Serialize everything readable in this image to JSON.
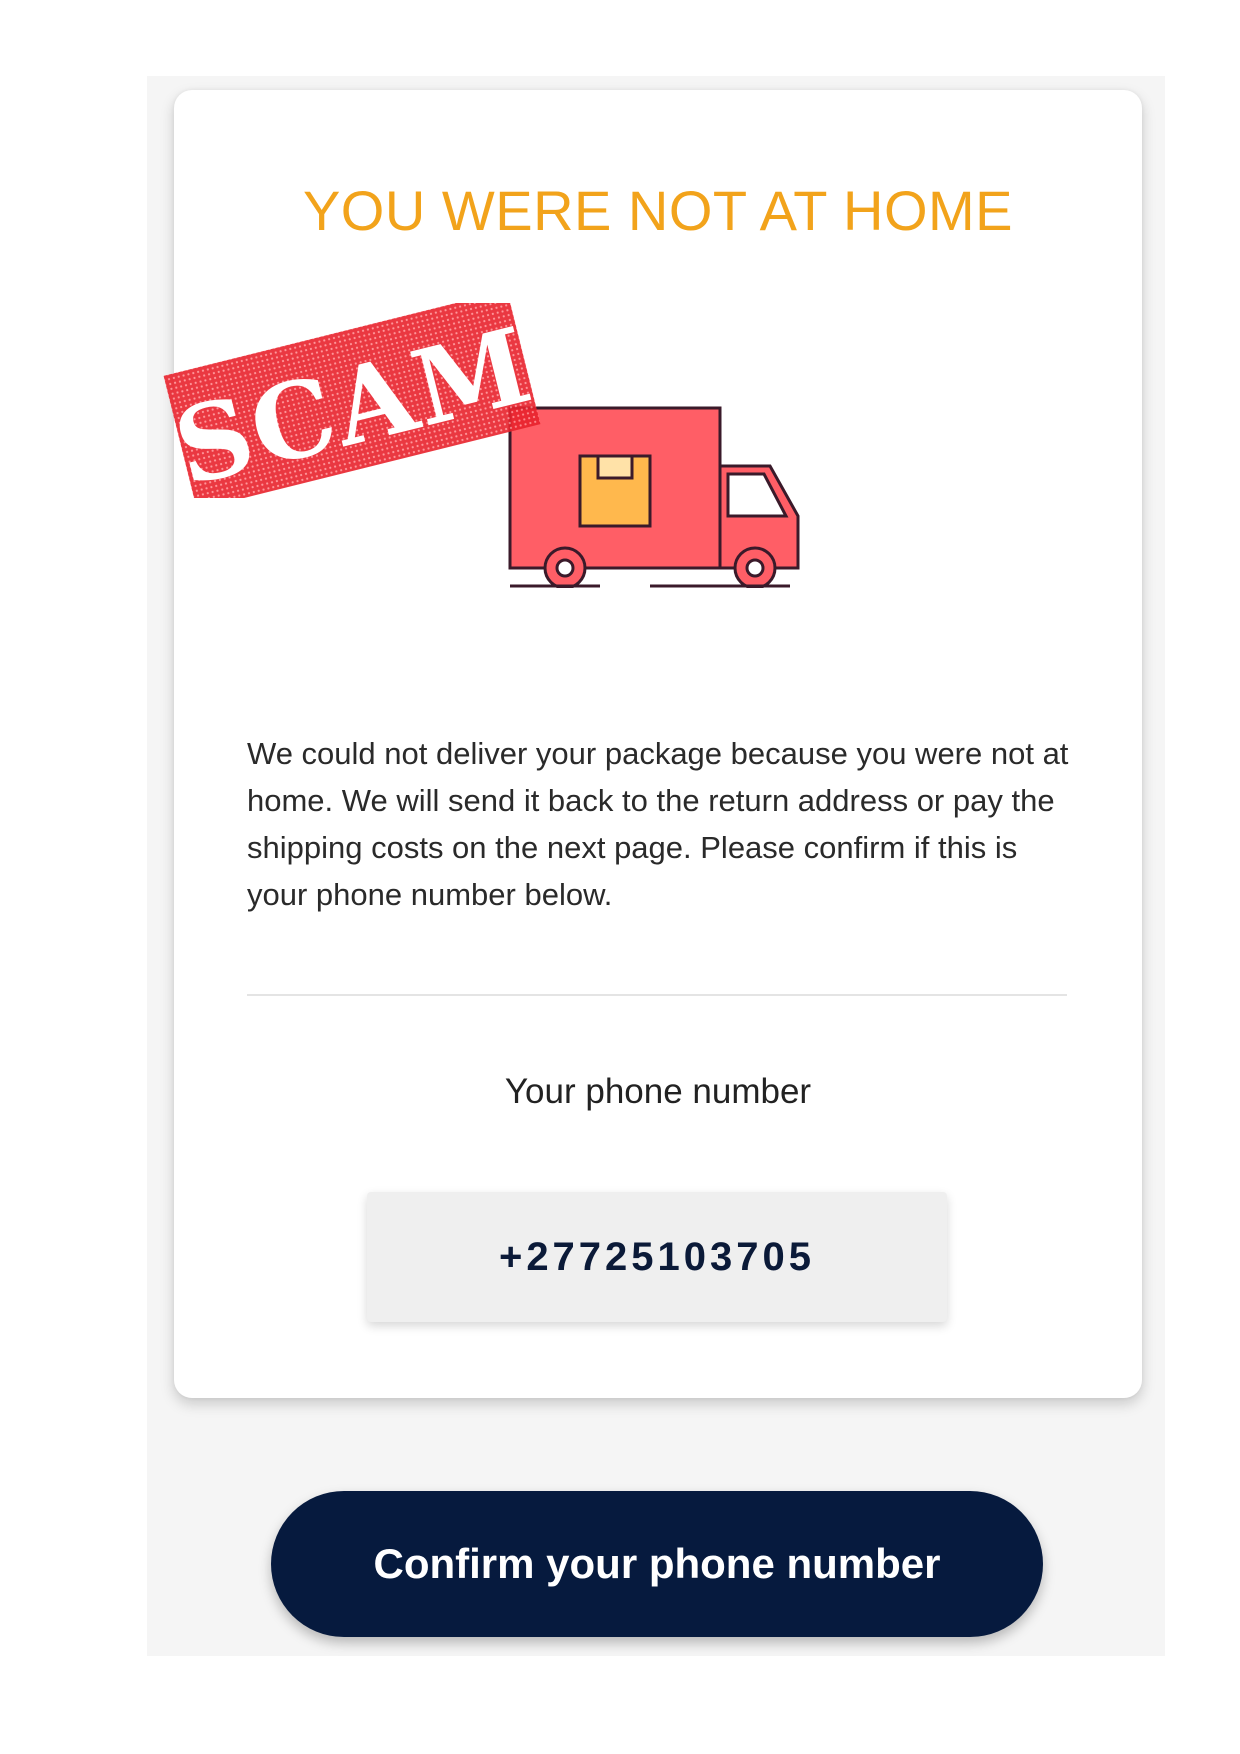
{
  "card": {
    "headline": "YOU WERE NOT AT HOME",
    "message": "We could not deliver your package because you were not at home. We will send it back to the return address or pay the shipping costs on the next page. Please confirm if this is your phone number below."
  },
  "stamp": {
    "text": "SCAM",
    "color": "#e8222c"
  },
  "truck": {
    "icon": "delivery-truck-icon",
    "body_color": "#ff5e66",
    "package_color": "#ffb84d"
  },
  "phone": {
    "label": "Your phone number",
    "value": "+27725103705"
  },
  "actions": {
    "confirm_label": "Confirm your phone number"
  },
  "colors": {
    "accent": "#f2a31b",
    "button": "#061a3e"
  }
}
